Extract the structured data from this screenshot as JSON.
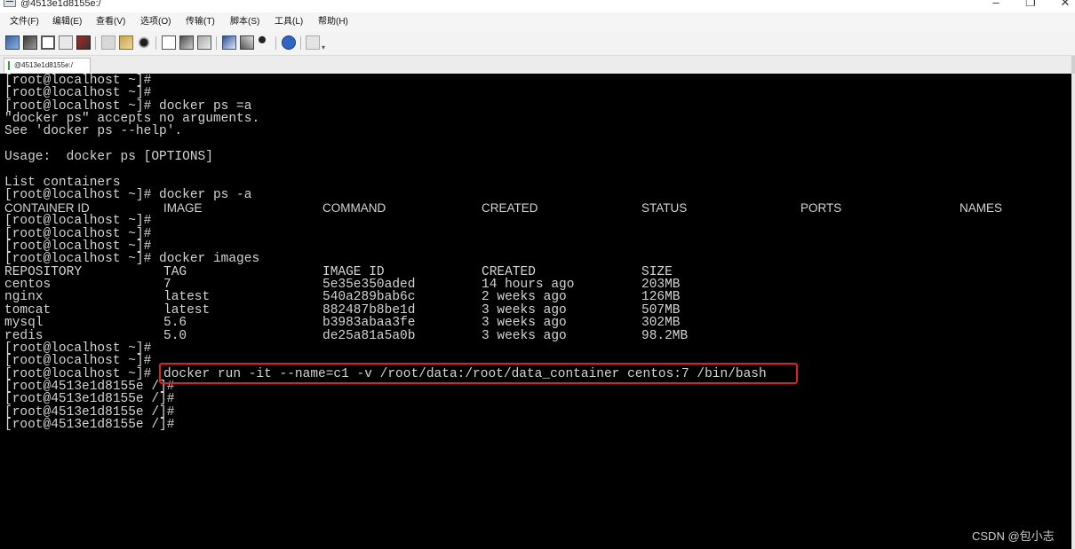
{
  "window": {
    "title": "@4513e1d8155e:/",
    "controls": [
      "–",
      "❐",
      "✕"
    ]
  },
  "menu": [
    "文件(F)",
    "编辑(E)",
    "查看(V)",
    "选项(O)",
    "传输(T)",
    "脚本(S)",
    "工具(L)",
    "帮助(H)"
  ],
  "toolbar": {
    "icons": [
      "new-session-icon",
      "open-session-icon",
      "reconnect-icon",
      "disconnect-icon",
      "close-icon",
      "copy-icon",
      "paste-icon",
      "find-icon",
      "print-setup-icon",
      "print-icon",
      "print-screen-icon",
      "session-options-icon",
      "global-options-icon",
      "keymap-icon",
      "help-icon",
      "extra-icon"
    ]
  },
  "tab": {
    "label": "@4513e1d8155e:/"
  },
  "terminal": {
    "lines": [
      "[root@localhost ~]#",
      "[root@localhost ~]#",
      "[root@localhost ~]# docker ps =a",
      "\"docker ps\" accepts no arguments.",
      "See 'docker ps --help'.",
      "",
      "Usage:  docker ps [OPTIONS]",
      "",
      "List containers",
      "[root@localhost ~]# docker ps -a"
    ],
    "ps_headers": [
      "CONTAINER ID",
      "IMAGE",
      "COMMAND",
      "CREATED",
      "STATUS",
      "PORTS",
      "NAMES"
    ],
    "lines_after_ps": [
      "[root@localhost ~]#",
      "[root@localhost ~]#",
      "[root@localhost ~]#",
      "[root@localhost ~]# docker images"
    ],
    "images_headers": [
      "REPOSITORY",
      "TAG",
      "IMAGE ID",
      "CREATED",
      "SIZE"
    ],
    "images_rows": [
      [
        "centos",
        "7",
        "5e35e350aded",
        "14 hours ago",
        "203MB"
      ],
      [
        "nginx",
        "latest",
        "540a289bab6c",
        "2 weeks ago",
        "126MB"
      ],
      [
        "tomcat",
        "latest",
        "882487b8be1d",
        "3 weeks ago",
        "507MB"
      ],
      [
        "mysql",
        "5.6",
        "b3983abaa3fe",
        "3 weeks ago",
        "302MB"
      ],
      [
        "redis",
        "5.0",
        "de25a81a5a0b",
        "3 weeks ago",
        "98.2MB"
      ]
    ],
    "lines_after_images": [
      "[root@localhost ~]#",
      "[root@localhost ~]#"
    ],
    "run_prompt": "[root@localhost ~]#",
    "run_command": "docker run -it --name=c1 -v /root/data:/root/data_container centos:7 /bin/bash",
    "container_prompts": [
      "[root@4513e1d8155e /]#",
      "[root@4513e1d8155e /]#",
      "[root@4513e1d8155e /]#",
      "[root@4513e1d8155e /]#"
    ],
    "highlight_color": "#e02020"
  },
  "watermark": "CSDN @包小志"
}
